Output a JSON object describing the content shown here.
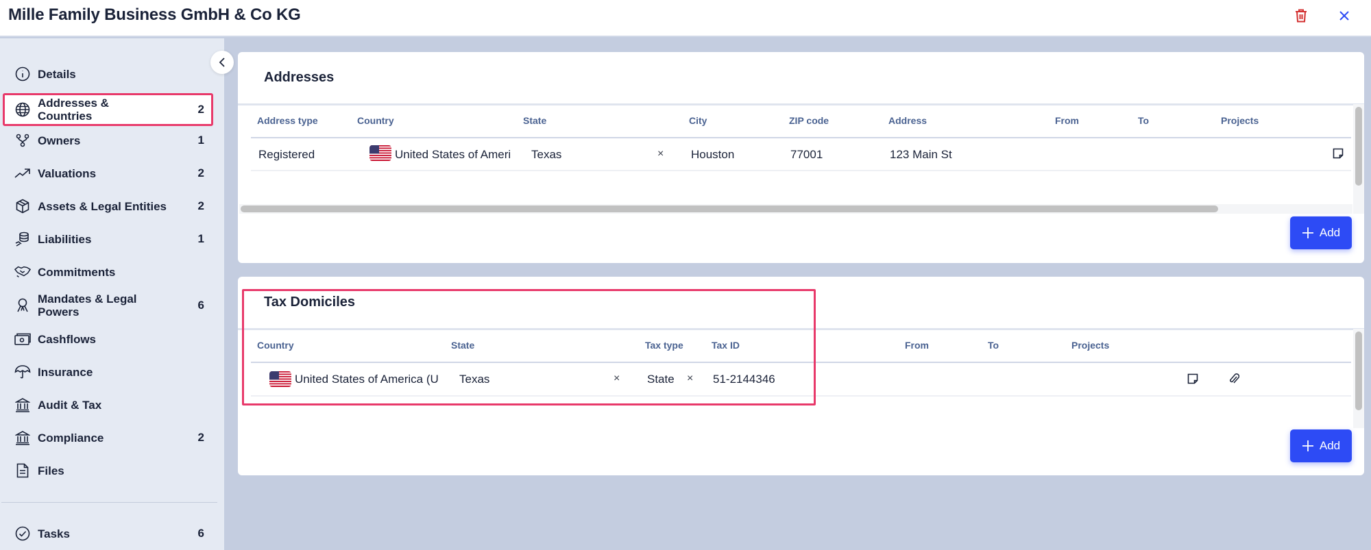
{
  "header": {
    "title": "Mille Family Business GmbH & Co KG",
    "delete_icon": "trash-icon",
    "close_icon": "close-icon",
    "delete_color": "#d32f2f",
    "close_color": "#2d4bf5"
  },
  "sidebar": {
    "collapse_icon": "chevron-left-icon",
    "items": [
      {
        "label": "Details",
        "count": "",
        "icon": "info-icon"
      },
      {
        "label": "Addresses & Countries",
        "count": "2",
        "icon": "globe-icon",
        "active": true
      },
      {
        "label": "Owners",
        "count": "1",
        "icon": "ownership-structure-icon"
      },
      {
        "label": "Valuations",
        "count": "2",
        "icon": "trending-up-icon"
      },
      {
        "label": "Assets & Legal Entities",
        "count": "2",
        "icon": "package-icon"
      },
      {
        "label": "Liabilities",
        "count": "1",
        "icon": "coins-icon"
      },
      {
        "label": "Commitments",
        "count": "",
        "icon": "handshake-icon"
      },
      {
        "label": "Mandates & Legal Powers",
        "count": "6",
        "icon": "award-icon"
      },
      {
        "label": "Cashflows",
        "count": "",
        "icon": "banknote-icon"
      },
      {
        "label": "Insurance",
        "count": "",
        "icon": "umbrella-icon"
      },
      {
        "label": "Audit & Tax",
        "count": "",
        "icon": "bank-icon"
      },
      {
        "label": "Compliance",
        "count": "2",
        "icon": "bank-icon"
      },
      {
        "label": "Files",
        "count": "",
        "icon": "file-icon"
      }
    ],
    "footer_items": [
      {
        "label": "Tasks",
        "count": "6",
        "icon": "check-circle-icon"
      }
    ]
  },
  "addresses": {
    "title": "Addresses",
    "columns": [
      "Address type",
      "Country",
      "State",
      "City",
      "ZIP code",
      "Address",
      "From",
      "To",
      "Projects"
    ],
    "rows": [
      {
        "address_type": "Registered",
        "country": "United States of Ameri",
        "country_flag": "us-flag-icon",
        "state": "Texas",
        "state_clear": "×",
        "city": "Houston",
        "zip": "77001",
        "address": "123 Main St",
        "from": "",
        "to": "",
        "projects": ""
      }
    ],
    "add_label": "Add"
  },
  "tax_domiciles": {
    "title": "Tax Domiciles",
    "columns": [
      "Country",
      "State",
      "Tax type",
      "Tax ID",
      "From",
      "To",
      "Projects"
    ],
    "rows": [
      {
        "country": "United States of America (U",
        "country_flag": "us-flag-icon",
        "state": "Texas",
        "state_clear": "×",
        "tax_type": "State",
        "tax_type_clear": "×",
        "tax_id": "51-2144346",
        "from": "",
        "to": "",
        "projects": ""
      }
    ],
    "add_label": "Add"
  },
  "colors": {
    "accent": "#2d4bf5",
    "highlight": "#e8396a",
    "header_text": "#4a6291",
    "sidebar_bg": "#e5eaf3",
    "page_bg": "#c4cde0"
  }
}
